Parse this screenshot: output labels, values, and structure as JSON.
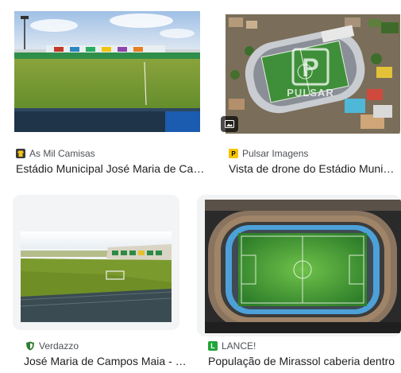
{
  "results": [
    {
      "source": "As Mil Camisas",
      "title": "Estádio Municipal José Maria de Campos Maia",
      "favicon_icon": "shirt-icon"
    },
    {
      "source": "Pulsar Imagens",
      "title": "Vista de drone do Estádio Municipal José Maria de Campos Maia",
      "favicon_icon": "pulsar-p-icon",
      "watermark": "P",
      "watermark_text": "PULSAR",
      "badge_icon": "image-icon"
    },
    {
      "source": "Verdazzo",
      "title": "José Maria de Campos Maia - Mirassol",
      "favicon_icon": "shield-icon"
    },
    {
      "source": "LANCE!",
      "title": "População de Mirassol caberia dentro",
      "favicon_icon": "lance-icon"
    }
  ],
  "colors": {
    "text_primary": "#202124",
    "text_secondary": "#4d5156",
    "pulsar_yellow": "#f5c400",
    "lance_green": "#22a538"
  }
}
